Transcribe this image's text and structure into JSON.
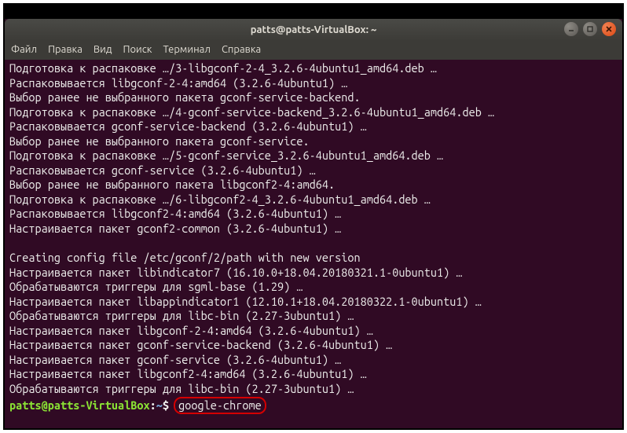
{
  "window": {
    "title": "patts@patts-VirtualBox: ~"
  },
  "menu": {
    "file": "Файл",
    "edit": "Правка",
    "view": "Вид",
    "search": "Поиск",
    "terminal": "Терминал",
    "help": "Справка"
  },
  "terminal": {
    "lines": [
      "Подготовка к распаковке …/3-libgconf-2-4_3.2.6-4ubuntu1_amd64.deb …",
      "Распаковывается libgconf-2-4:amd64 (3.2.6-4ubuntu1) …",
      "Выбор ранее не выбранного пакета gconf-service-backend.",
      "Подготовка к распаковке …/4-gconf-service-backend_3.2.6-4ubuntu1_amd64.deb …",
      "Распаковывается gconf-service-backend (3.2.6-4ubuntu1) …",
      "Выбор ранее не выбранного пакета gconf-service.",
      "Подготовка к распаковке …/5-gconf-service_3.2.6-4ubuntu1_amd64.deb …",
      "Распаковывается gconf-service (3.2.6-4ubuntu1) …",
      "Выбор ранее не выбранного пакета libgconf2-4:amd64.",
      "Подготовка к распаковке …/6-libgconf2-4_3.2.6-4ubuntu1_amd64.deb …",
      "Распаковывается libgconf2-4:amd64 (3.2.6-4ubuntu1) …",
      "Настраивается пакет gconf2-common (3.2.6-4ubuntu1) …",
      "",
      "Creating config file /etc/gconf/2/path with new version",
      "Настраивается пакет libindicator7 (16.10.0+18.04.20180321.1-0ubuntu1) …",
      "Обрабатываются триггеры для sgml-base (1.29) …",
      "Настраивается пакет libappindicator1 (12.10.1+18.04.20180322.1-0ubuntu1) …",
      "Обрабатываются триггеры для libc-bin (2.27-3ubuntu1) …",
      "Настраивается пакет libgconf-2-4:amd64 (3.2.6-4ubuntu1) …",
      "Настраивается пакет gconf-service-backend (3.2.6-4ubuntu1) …",
      "Настраивается пакет gconf-service (3.2.6-4ubuntu1) …",
      "Настраивается пакет libgconf2-4:amd64 (3.2.6-4ubuntu1) …",
      "Обрабатываются триггеры для libc-bin (2.27-3ubuntu1) …"
    ],
    "prompt": {
      "user_host": "patts@patts-VirtualBox",
      "sep1": ":",
      "path": "~",
      "sep2": "$",
      "command": "google-chrome"
    }
  }
}
